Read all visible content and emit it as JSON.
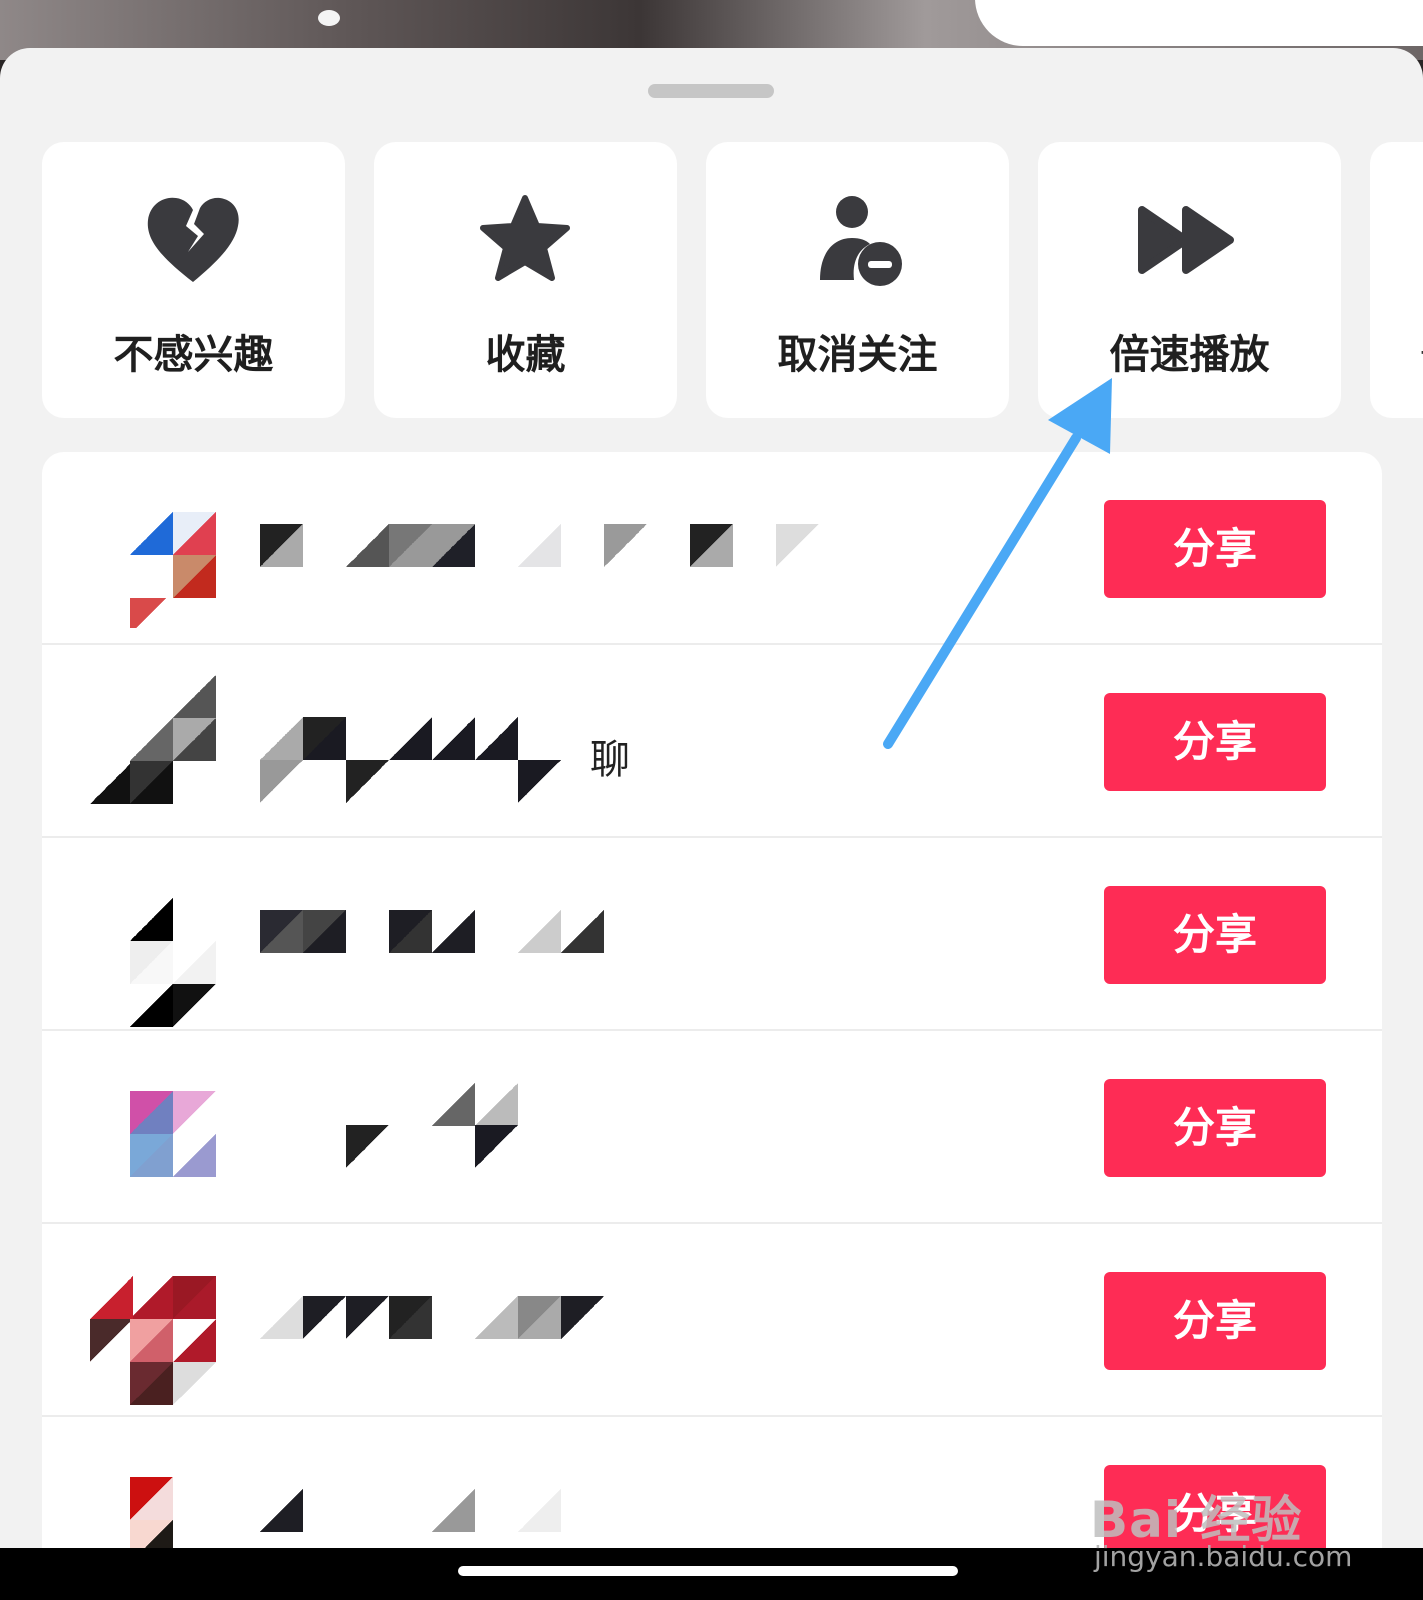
{
  "actions": [
    {
      "label": "不感兴趣",
      "icon": "broken-heart-icon"
    },
    {
      "label": "收藏",
      "icon": "star-icon"
    },
    {
      "label": "取消关注",
      "icon": "user-minus-icon"
    },
    {
      "label": "倍速播放",
      "icon": "fast-forward-icon"
    }
  ],
  "peek_card_text": "+",
  "share_rows": [
    {
      "name": "",
      "share_label": "分享"
    },
    {
      "name": "聊",
      "share_label": "分享"
    },
    {
      "name": "",
      "share_label": "分享"
    },
    {
      "name": "",
      "share_label": "分享"
    },
    {
      "name": "",
      "share_label": "分享"
    },
    {
      "name": "",
      "share_label": "分享"
    }
  ],
  "watermark": {
    "logo": "Bai 经验",
    "url": "jingyan.baidu.com"
  },
  "colors": {
    "share_button": "#fe2c55",
    "annotation_arrow": "#4aa8f5",
    "icon": "#3a3a3e"
  }
}
